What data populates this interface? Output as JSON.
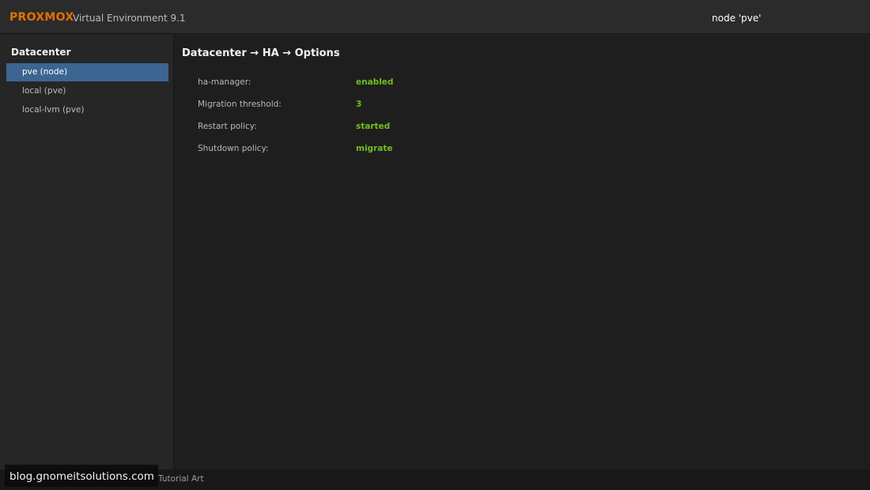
{
  "header": {
    "brand": "PROXMOX",
    "version": "Virtual Environment 9.1",
    "node_label": "node 'pve'"
  },
  "sidebar": {
    "title": "Datacenter",
    "items": [
      {
        "label": "pve (node)",
        "selected": true
      },
      {
        "label": "local (pve)",
        "selected": false
      },
      {
        "label": "local-lvm (pve)",
        "selected": false
      }
    ]
  },
  "main": {
    "title": "Datacenter → HA → Options",
    "options": [
      {
        "key": "ha-manager:",
        "value": "enabled"
      },
      {
        "key": "Migration threshold:",
        "value": "3"
      },
      {
        "key": "Restart policy:",
        "value": "started"
      },
      {
        "key": "Shutdown policy:",
        "value": "migrate"
      }
    ]
  },
  "footer": {
    "text": "Tutorial Art"
  },
  "watermark": {
    "text": "blog.gnomeitsolutions.com"
  },
  "colors": {
    "brand": "#e57000",
    "selected_bg": "#3c6591",
    "value_green": "#6fbf1f"
  }
}
